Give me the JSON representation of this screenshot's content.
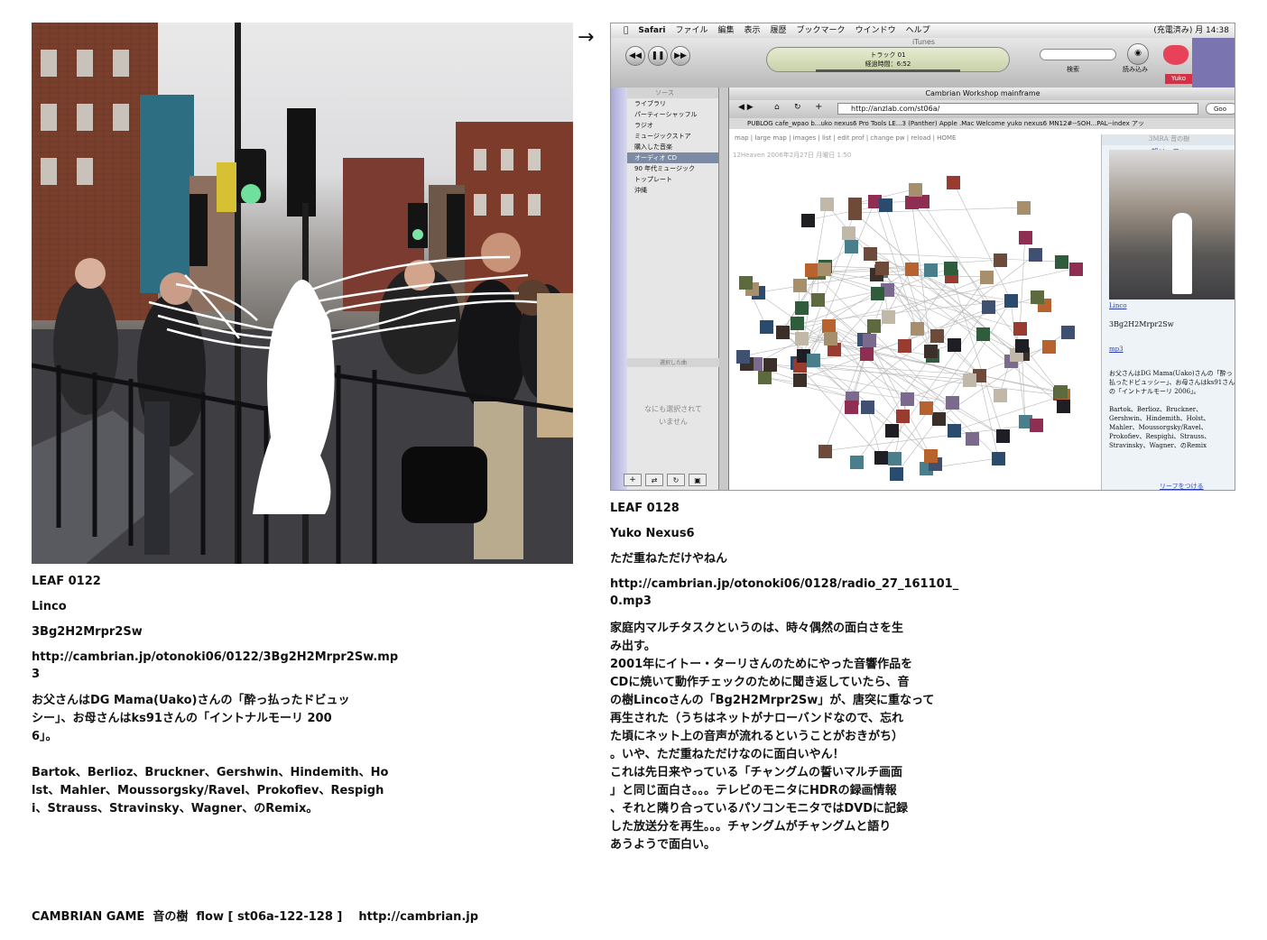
{
  "left_leaf": {
    "id": "LEAF 0122",
    "author": "Linco",
    "title": "3Bg2H2Mrpr2Sw",
    "url_line1": "http://cambrian.jp/otonoki06/0122/3Bg2H2Mrpr2Sw.mp",
    "url_line2": "3",
    "desc_line1": "お父さんはDG Mama(Uako)さんの「酔っ払ったドビュッ",
    "desc_line2": "シー」、お母さんはks91さんの「イントナルモーリ 200",
    "desc_line3": "6」。",
    "composers_line1": "Bartok、Berlioz、Bruckner、Gershwin、Hindemith、Ho",
    "composers_line2": "lst、Mahler、Moussorgsky/Ravel、Prokofiev、Respigh",
    "composers_line3": "i、Strauss、Stravinsky、Wagner、のRemix。"
  },
  "right_leaf": {
    "id": "LEAF 0128",
    "author": "Yuko Nexus6",
    "title": "ただ重ねただけやねん",
    "url_line1": "http://cambrian.jp/otonoki06/0128/radio_27_161101_",
    "url_line2": "0.mp3",
    "body_lines": [
      "家庭内マルチタスクというのは、時々偶然の面白さを生",
      "み出す。",
      "2001年にイトー・ターリさんのためにやった音響作品を",
      "CDに焼いて動作チェックのために聞き返していたら、音",
      "の樹Lincoさんの「Bg2H2Mrpr2Sw」が、唐突に重なって",
      "再生された（うちはネットがナローバンドなので、忘れ",
      "た頃にネット上の音声が流れるということがおきがち）",
      "。いや、ただ重ねただけなのに面白いやん！",
      "これは先日来やっている「チャングムの誓いマルチ画面",
      "」と同じ面白さ。。。テレビのモニタにHDRの録画情報",
      "、それと隣り合っているパソコンモニタではDVDに記録",
      "した放送分を再生。。。チャングムがチャングムと語り",
      "あうようで面白い。"
    ]
  },
  "arrow": "→",
  "footer": "CAMBRIAN GAME  音の樹  flow [ st06a-122-128 ]    http://cambrian.jp",
  "screenshot": {
    "menubar": [
      "Safari",
      "ファイル",
      "編集",
      "表示",
      "履歴",
      "ブックマーク",
      "ウインドウ",
      "ヘルプ"
    ],
    "menubar_right": "(充電済み)  月 14:38",
    "itunes_title": "iTunes",
    "lcd_track": "トラック 01",
    "lcd_time": "経過時間：6:52",
    "search_label": "検索",
    "import_label": "読み込み",
    "yuko_label": "Yuko",
    "source_header": "ソース",
    "sources": [
      "ライブラリ",
      "パーティーシャッフル",
      "ラジオ",
      "ミュージックストア",
      "購入した音楽",
      "オーディオ CD",
      "90 年代ミュージック",
      "トップレート",
      "沖縄"
    ],
    "selected_header": "選択した曲",
    "nothing_selected": "なにも選択されて\nいません",
    "browser_title": "Cambrian Workshop mainframe",
    "url": "http://anzlab.com/st06a/",
    "google": "Goo",
    "bookmarks": "PUBLOG   cafe_wpao b...uko nexus6   Pro Tools LE...3 (Panther)   Apple .Mac Welcome   yuko nexus6   MN12#--SOH...PAL--index   アッ",
    "page_nav": "map | large map | images | list | edit prof | change pw | reload | HOME",
    "panel_header": "3MRA 音の樹",
    "parent_link": "親リーフへ",
    "panel_linco": "Linco",
    "panel_title": "3Bg2H2Mrpr2Sw",
    "panel_mp3": "mp3",
    "panel_desc": "お父さんはDG Mama(Uako)さんの「酔っ払ったドビュッシー」、お母さんはks91さんの「イントナルモーリ 2006」。",
    "panel_composers": "Bartok、Berlioz、Bruckner、Gershwin、Hindemith、Holst、Mahler、Moussorgsky/Ravel、Prokofiev、Respighi、Strauss、Stravinsky、Wagner、のRemix",
    "attach_link": "リーフをつける",
    "stamp": "12Heaven 2006年2月27日 月曜日 1:50"
  },
  "colors": {
    "accent_link": "#2a3eb1",
    "lcd": "#d7dfbf",
    "sel": "#7c8aa3"
  }
}
